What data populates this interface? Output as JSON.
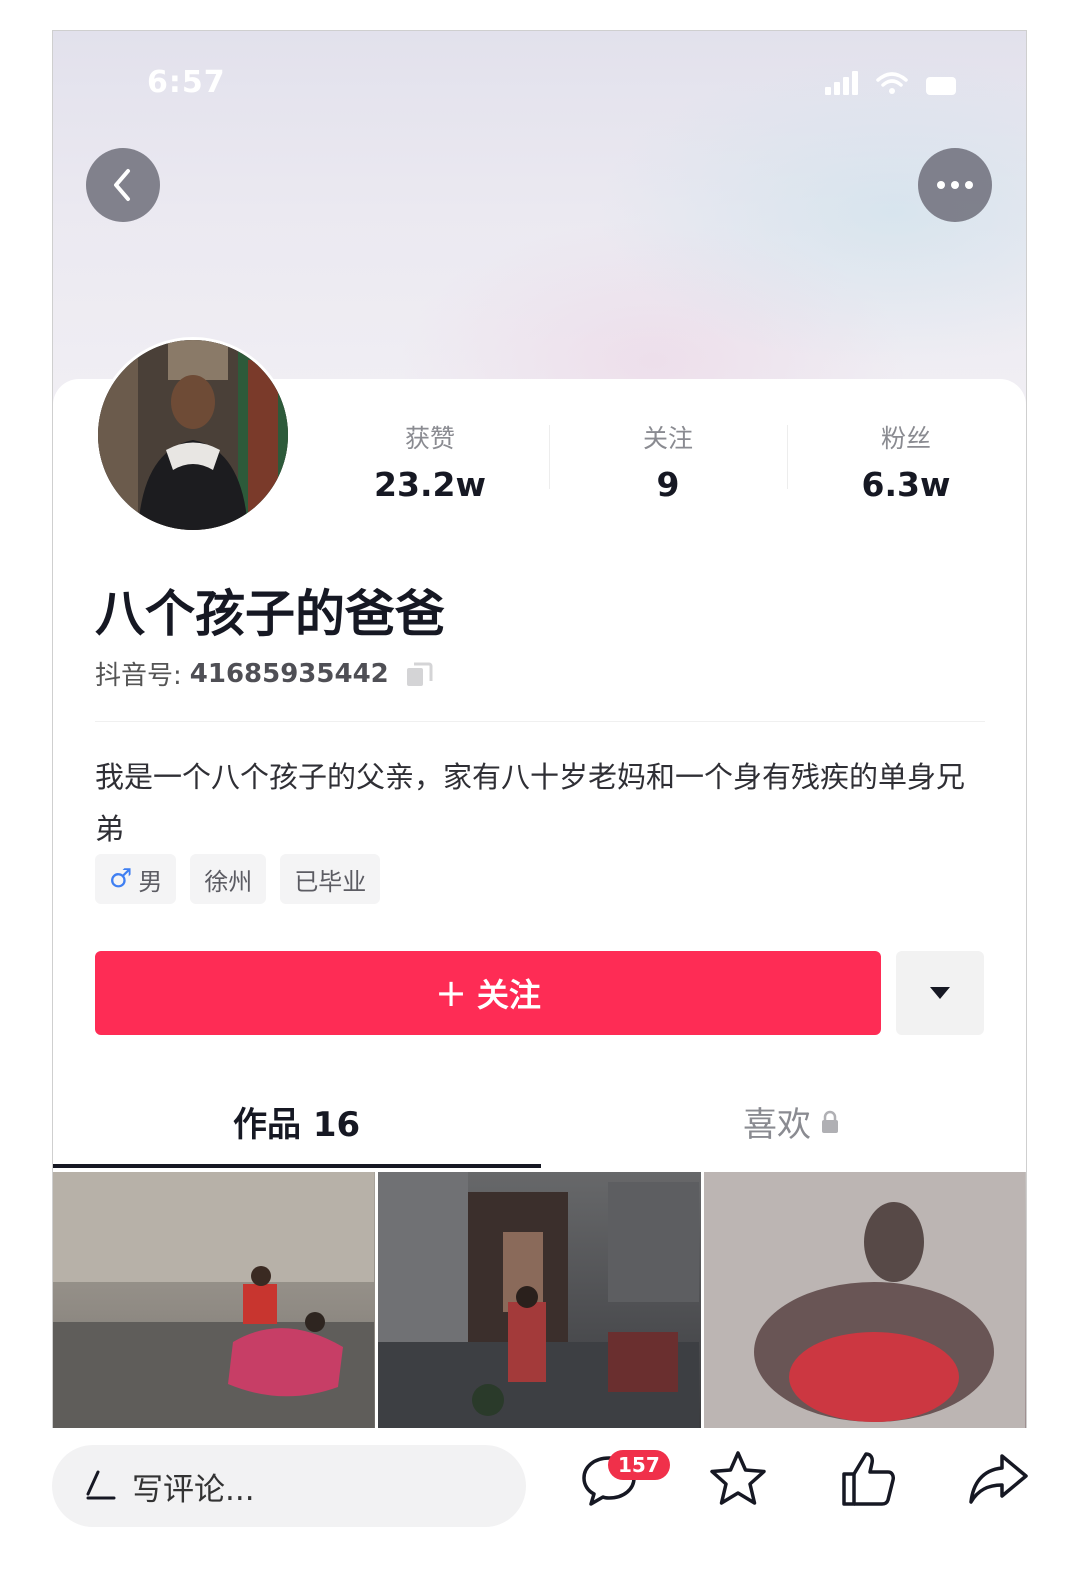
{
  "status_bar": {
    "time": "6:57"
  },
  "profile": {
    "stats": [
      {
        "label": "获赞",
        "value": "23.2w"
      },
      {
        "label": "关注",
        "value": "9"
      },
      {
        "label": "粉丝",
        "value": "6.3w"
      }
    ],
    "name": "八个孩子的爸爸",
    "id_label": "抖音号:",
    "id_value": "41685935442",
    "bio": "我是一个八个孩子的父亲，家有八十岁老妈和一个身有残疾的单身兄弟",
    "tags": {
      "gender_symbol": "♂",
      "gender": "男",
      "city": "徐州",
      "education": "已毕业"
    },
    "follow_plus": "+",
    "follow_label": "关注"
  },
  "tabs": {
    "works_label": "作品 16",
    "likes_label": "喜欢"
  },
  "bottom_bar": {
    "comment_placeholder": "写评论...",
    "comment_count": "157"
  },
  "colors": {
    "follow_button": "#fe2c55",
    "badge": "#f0304a",
    "gender_icon": "#3f7ff2"
  },
  "icons": [
    "back-icon",
    "more-icon",
    "copy-icon",
    "dropdown-icon",
    "lock-icon",
    "pen-icon",
    "comment-icon",
    "star-icon",
    "like-icon",
    "share-icon"
  ]
}
